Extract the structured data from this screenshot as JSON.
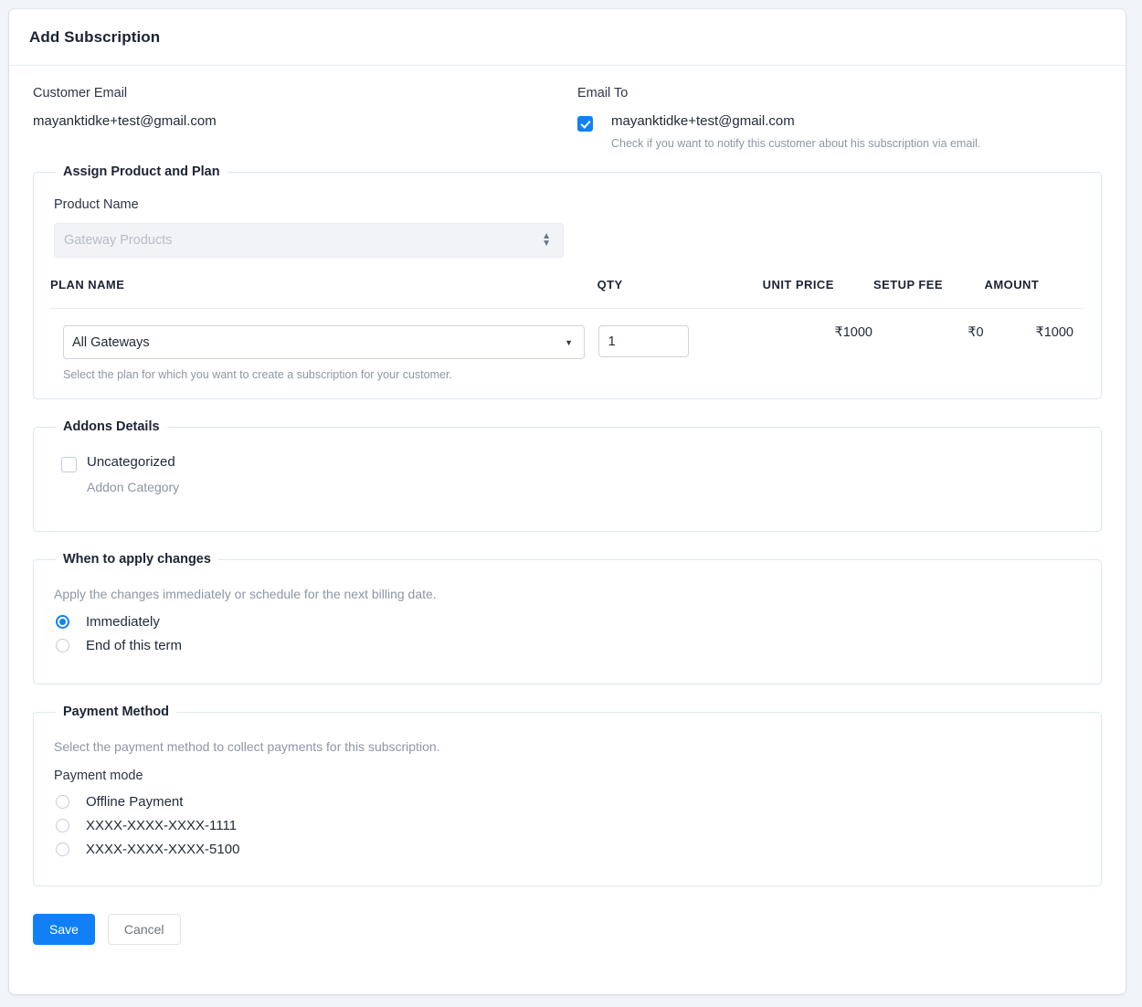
{
  "header": {
    "title": "Add Subscription"
  },
  "customer": {
    "email_label": "Customer Email",
    "email_value": "mayanktidke+test@gmail.com"
  },
  "email_to": {
    "label": "Email To",
    "checkbox_label": "mayanktidke+test@gmail.com",
    "checked": true,
    "help": "Check if you want to notify this customer about his subscription via email."
  },
  "assign_product": {
    "legend": "Assign Product and Plan",
    "product_name_label": "Product Name",
    "product_select_value": "Gateway Products",
    "product_select_disabled": true,
    "table": {
      "headers": [
        "PLAN NAME",
        "QTY",
        "UNIT PRICE",
        "SETUP FEE",
        "AMOUNT"
      ],
      "rows": [
        {
          "plan": "All Gateways",
          "qty": "1",
          "unit_price": "₹1000",
          "setup_fee": "₹0",
          "amount": "₹1000"
        }
      ],
      "plan_help": "Select the plan for which you want to create a subscription for your customer."
    }
  },
  "addons": {
    "legend": "Addons Details",
    "items": [
      {
        "label": "Uncategorized",
        "sub": "Addon Category",
        "checked": false
      }
    ]
  },
  "when_to_apply": {
    "legend": "When to apply changes",
    "description": "Apply the changes immediately or schedule for the next billing date.",
    "options": [
      {
        "label": "Immediately",
        "selected": true
      },
      {
        "label": "End of this term",
        "selected": false
      }
    ]
  },
  "payment_method": {
    "legend": "Payment Method",
    "description": "Select the payment method to collect payments for this subscription.",
    "mode_label": "Payment mode",
    "options": [
      {
        "label": "Offline Payment",
        "selected": false
      },
      {
        "label": "XXXX-XXXX-XXXX-1111",
        "selected": false
      },
      {
        "label": "XXXX-XXXX-XXXX-5100",
        "selected": false
      }
    ]
  },
  "footer": {
    "save_label": "Save",
    "cancel_label": "Cancel"
  },
  "icons": {
    "select_updown": "⬍",
    "select_caret": "▼"
  },
  "colors": {
    "accent": "#1180f6",
    "page_bg": "#f1f4f8",
    "fieldset_border": "#dbe6f6"
  }
}
